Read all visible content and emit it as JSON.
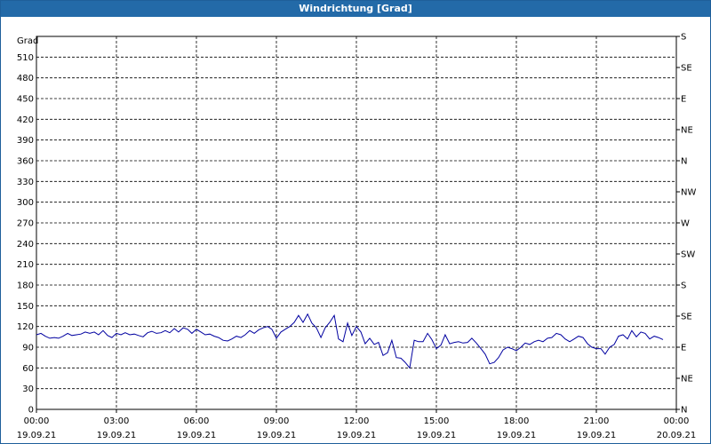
{
  "window": {
    "title": "Windrichtung [Grad]"
  },
  "chart_data": {
    "type": "line",
    "title": "Windrichtung [Grad]",
    "ylabel": "Grad",
    "xlabel": "",
    "x_unit": "hours since 00:00 19.09.21",
    "xlim": [
      0,
      24
    ],
    "ylim": [
      0,
      540
    ],
    "y_ticks": [
      0,
      30,
      60,
      90,
      120,
      150,
      180,
      210,
      240,
      270,
      300,
      330,
      360,
      390,
      420,
      450,
      480,
      510
    ],
    "x_ticks": [
      {
        "x": 0,
        "time": "00:00",
        "date": "19.09.21"
      },
      {
        "x": 3,
        "time": "03:00",
        "date": "19.09.21"
      },
      {
        "x": 6,
        "time": "06:00",
        "date": "19.09.21"
      },
      {
        "x": 9,
        "time": "09:00",
        "date": "19.09.21"
      },
      {
        "x": 12,
        "time": "12:00",
        "date": "19.09.21"
      },
      {
        "x": 15,
        "time": "15:00",
        "date": "19.09.21"
      },
      {
        "x": 18,
        "time": "18:00",
        "date": "19.09.21"
      },
      {
        "x": 21,
        "time": "21:00",
        "date": "19.09.21"
      },
      {
        "x": 24,
        "time": "00:00",
        "date": "20.09.21"
      }
    ],
    "right_axis": [
      {
        "value": 0,
        "label": "N"
      },
      {
        "value": 45,
        "label": "NE"
      },
      {
        "value": 90,
        "label": "E"
      },
      {
        "value": 135,
        "label": "SE"
      },
      {
        "value": 180,
        "label": "S"
      },
      {
        "value": 225,
        "label": "SW"
      },
      {
        "value": 270,
        "label": "W"
      },
      {
        "value": 315,
        "label": "NW"
      },
      {
        "value": 360,
        "label": "N"
      },
      {
        "value": 405,
        "label": "NE"
      },
      {
        "value": 450,
        "label": "E"
      },
      {
        "value": 495,
        "label": "SE"
      },
      {
        "value": 540,
        "label": "S"
      }
    ],
    "grid": true,
    "colors": {
      "line": "#0000a0",
      "grid": "#000000",
      "title_bar": "#236aa8"
    },
    "series": [
      {
        "name": "",
        "points": [
          [
            0.0,
            108
          ],
          [
            0.17,
            110
          ],
          [
            0.33,
            106
          ],
          [
            0.5,
            103
          ],
          [
            0.67,
            104
          ],
          [
            0.83,
            103
          ],
          [
            1.0,
            106
          ],
          [
            1.17,
            110
          ],
          [
            1.33,
            107
          ],
          [
            1.5,
            108
          ],
          [
            1.67,
            109
          ],
          [
            1.83,
            112
          ],
          [
            2.0,
            110
          ],
          [
            2.17,
            112
          ],
          [
            2.33,
            108
          ],
          [
            2.5,
            114
          ],
          [
            2.67,
            107
          ],
          [
            2.83,
            104
          ],
          [
            3.0,
            110
          ],
          [
            3.17,
            108
          ],
          [
            3.33,
            111
          ],
          [
            3.5,
            108
          ],
          [
            3.67,
            109
          ],
          [
            3.83,
            107
          ],
          [
            4.0,
            105
          ],
          [
            4.17,
            111
          ],
          [
            4.33,
            113
          ],
          [
            4.5,
            110
          ],
          [
            4.67,
            111
          ],
          [
            4.83,
            114
          ],
          [
            5.0,
            111
          ],
          [
            5.17,
            117
          ],
          [
            5.33,
            112
          ],
          [
            5.5,
            118
          ],
          [
            5.67,
            116
          ],
          [
            5.83,
            110
          ],
          [
            6.0,
            116
          ],
          [
            6.17,
            112
          ],
          [
            6.33,
            108
          ],
          [
            6.5,
            109
          ],
          [
            6.67,
            106
          ],
          [
            6.83,
            104
          ],
          [
            7.0,
            100
          ],
          [
            7.17,
            99
          ],
          [
            7.33,
            102
          ],
          [
            7.5,
            106
          ],
          [
            7.67,
            104
          ],
          [
            7.83,
            108
          ],
          [
            8.0,
            114
          ],
          [
            8.17,
            110
          ],
          [
            8.33,
            115
          ],
          [
            8.5,
            118
          ],
          [
            8.67,
            120
          ],
          [
            8.83,
            116
          ],
          [
            9.0,
            103
          ],
          [
            9.17,
            112
          ],
          [
            9.33,
            116
          ],
          [
            9.5,
            120
          ],
          [
            9.67,
            126
          ],
          [
            9.83,
            136
          ],
          [
            10.0,
            126
          ],
          [
            10.17,
            138
          ],
          [
            10.33,
            125
          ],
          [
            10.5,
            118
          ],
          [
            10.67,
            104
          ],
          [
            10.83,
            118
          ],
          [
            11.0,
            126
          ],
          [
            11.17,
            136
          ],
          [
            11.33,
            102
          ],
          [
            11.5,
            98
          ],
          [
            11.67,
            125
          ],
          [
            11.83,
            107
          ],
          [
            12.0,
            120
          ],
          [
            12.17,
            112
          ],
          [
            12.33,
            95
          ],
          [
            12.5,
            103
          ],
          [
            12.67,
            94
          ],
          [
            12.83,
            97
          ],
          [
            13.0,
            78
          ],
          [
            13.17,
            82
          ],
          [
            13.33,
            100
          ],
          [
            13.5,
            75
          ],
          [
            13.67,
            74
          ],
          [
            13.83,
            68
          ],
          [
            14.0,
            60
          ],
          [
            14.17,
            100
          ],
          [
            14.33,
            98
          ],
          [
            14.5,
            98
          ],
          [
            14.67,
            110
          ],
          [
            14.83,
            101
          ],
          [
            15.0,
            88
          ],
          [
            15.17,
            93
          ],
          [
            15.33,
            108
          ],
          [
            15.5,
            95
          ],
          [
            15.67,
            97
          ],
          [
            15.83,
            98
          ],
          [
            16.0,
            96
          ],
          [
            16.17,
            97
          ],
          [
            16.33,
            103
          ],
          [
            16.5,
            96
          ],
          [
            16.67,
            88
          ],
          [
            16.83,
            80
          ],
          [
            17.0,
            66
          ],
          [
            17.17,
            68
          ],
          [
            17.33,
            75
          ],
          [
            17.5,
            86
          ],
          [
            17.67,
            90
          ],
          [
            17.83,
            88
          ],
          [
            18.0,
            85
          ],
          [
            18.17,
            90
          ],
          [
            18.33,
            96
          ],
          [
            18.5,
            94
          ],
          [
            18.67,
            98
          ],
          [
            18.83,
            100
          ],
          [
            19.0,
            98
          ],
          [
            19.17,
            103
          ],
          [
            19.33,
            104
          ],
          [
            19.5,
            110
          ],
          [
            19.67,
            108
          ],
          [
            19.83,
            102
          ],
          [
            20.0,
            98
          ],
          [
            20.17,
            102
          ],
          [
            20.33,
            106
          ],
          [
            20.5,
            104
          ],
          [
            20.67,
            95
          ],
          [
            20.83,
            90
          ],
          [
            21.0,
            88
          ],
          [
            21.17,
            88
          ],
          [
            21.33,
            80
          ],
          [
            21.5,
            90
          ],
          [
            21.67,
            94
          ],
          [
            21.83,
            106
          ],
          [
            22.0,
            108
          ],
          [
            22.17,
            102
          ],
          [
            22.33,
            114
          ],
          [
            22.5,
            105
          ],
          [
            22.67,
            112
          ],
          [
            22.83,
            110
          ],
          [
            23.0,
            102
          ],
          [
            23.17,
            106
          ],
          [
            23.33,
            104
          ],
          [
            23.5,
            101
          ]
        ]
      }
    ]
  }
}
